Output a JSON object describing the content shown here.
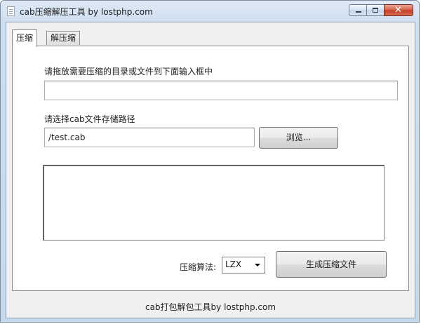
{
  "window": {
    "title": "cab压缩解压工具 by lostphp.com",
    "minimize_label": "",
    "close_glyph": "✕"
  },
  "tabs": [
    {
      "label": "压缩",
      "active": true
    },
    {
      "label": "解压缩",
      "active": false
    }
  ],
  "compress": {
    "source_label": "请拖放需要压缩的目录或文件到下面输入框中",
    "source_value": "",
    "dest_label": "请选择cab文件存储路径",
    "dest_value": "/test.cab",
    "browse_label": "浏览...",
    "algorithm_label": "压缩算法:",
    "algorithm_value": "LZX",
    "generate_label": "生成压缩文件"
  },
  "footer": {
    "text": "cab打包解包工具by lostphp.com"
  }
}
